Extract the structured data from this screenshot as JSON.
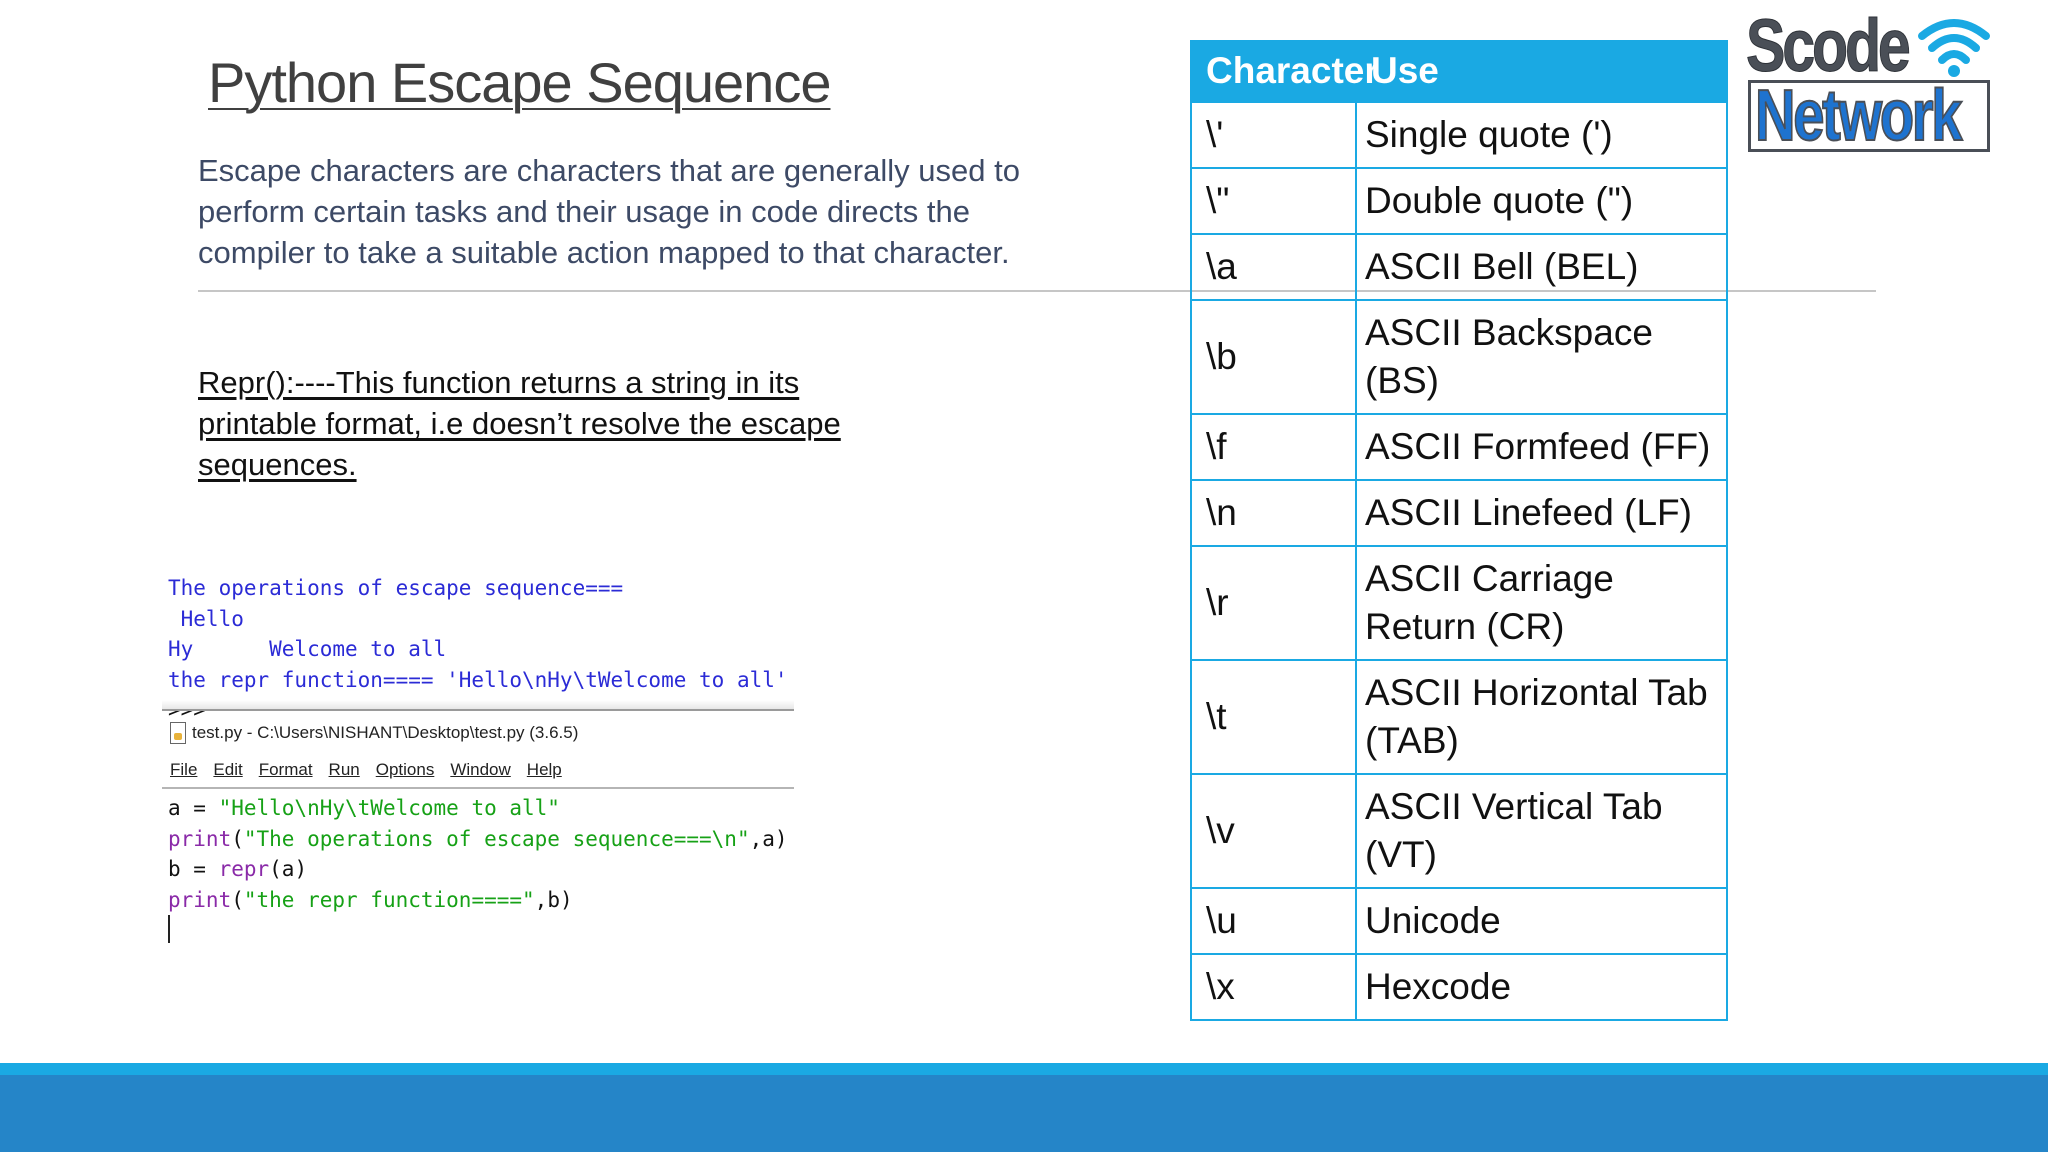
{
  "slide": {
    "title": "Python Escape Sequence",
    "intro": "Escape characters are characters that are generally used to perform certain tasks and their usage in code directs the compiler to take a suitable action mapped to that character.",
    "repr_note": "Repr():----This function returns a string in its printable format, i.e doesn’t resolve the escape sequences."
  },
  "shell_output": {
    "lines": [
      "The operations of escape sequence===",
      " Hello",
      "Hy      Welcome to all",
      "the repr function==== 'Hello\\nHy\\tWelcome to all'",
      ">>>"
    ]
  },
  "editor": {
    "window_title": "test.py - C:\\Users\\NISHANT\\Desktop\\test.py (3.6.5)",
    "menu": [
      "File",
      "Edit",
      "Format",
      "Run",
      "Options",
      "Window",
      "Help"
    ],
    "code": {
      "l1_a": "a = ",
      "l1_b": "\"Hello\\nHy\\tWelcome to all\"",
      "l2_a": "print",
      "l2_b": "(",
      "l2_c": "\"The operations of escape sequence===\\n\"",
      "l2_d": ",a)",
      "l3_a": "b = ",
      "l3_b": "repr",
      "l3_c": "(a)",
      "l4_a": "print",
      "l4_b": "(",
      "l4_c": "\"the repr function====\"",
      "l4_d": ",b)"
    }
  },
  "table": {
    "headers": [
      "Character",
      "Use"
    ],
    "rows": [
      {
        "char": "\\'",
        "use": "Single quote (')"
      },
      {
        "char": "\\\"",
        "use": "Double quote (\")"
      },
      {
        "char": "\\a",
        "use": "ASCII Bell (BEL)"
      },
      {
        "char": "\\b",
        "use": "ASCII Backspace (BS)"
      },
      {
        "char": "\\f",
        "use": "ASCII Formfeed (FF)"
      },
      {
        "char": "\\n",
        "use": "ASCII Linefeed (LF)"
      },
      {
        "char": "\\r",
        "use": "ASCII Carriage Return (CR)"
      },
      {
        "char": "\\t",
        "use": "ASCII Horizontal Tab (TAB)"
      },
      {
        "char": "\\v",
        "use": "ASCII Vertical Tab (VT)"
      },
      {
        "char": "\\u",
        "use": "Unicode"
      },
      {
        "char": "\\x",
        "use": "Hexcode"
      }
    ]
  },
  "logo": {
    "top": "Scode",
    "bottom": "Network",
    "icon": "wifi-icon"
  },
  "colors": {
    "accent": "#1aa9e3",
    "footer": "#2585c8",
    "intro_text": "#3d4a66",
    "code_blue": "#2b2bd6",
    "code_green": "#16a116",
    "code_purple": "#8a2aa8"
  }
}
